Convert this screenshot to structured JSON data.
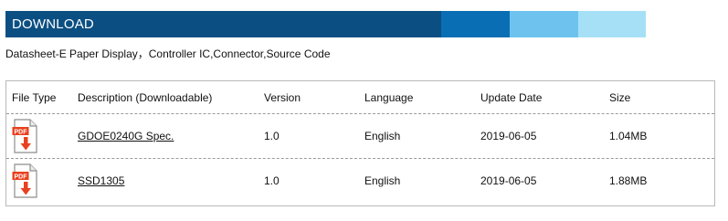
{
  "banner": {
    "title": "DOWNLOAD",
    "colors": [
      "#0b4f82",
      "#0a6eb4",
      "#6ec3ee",
      "#a6e0f7"
    ]
  },
  "subtitle": "Datasheet-E Paper Display，Controller IC,Connector,Source Code",
  "table": {
    "headers": [
      "File Type",
      "Description (Downloadable)",
      "Version",
      "Language",
      "Update Date",
      "Size"
    ],
    "rows": [
      {
        "file_type_icon": "pdf-download-icon",
        "description": "GDOE0240G Spec.",
        "version": "1.0",
        "language": "English",
        "update_date": "2019-06-05",
        "size": "1.04MB"
      },
      {
        "file_type_icon": "pdf-download-icon",
        "description": "SSD1305",
        "version": "1.0",
        "language": "English",
        "update_date": "2019-06-05",
        "size": "1.88MB"
      }
    ]
  },
  "icon_label": "PDF",
  "accent_colors": {
    "pdf_red": "#e8411f"
  }
}
